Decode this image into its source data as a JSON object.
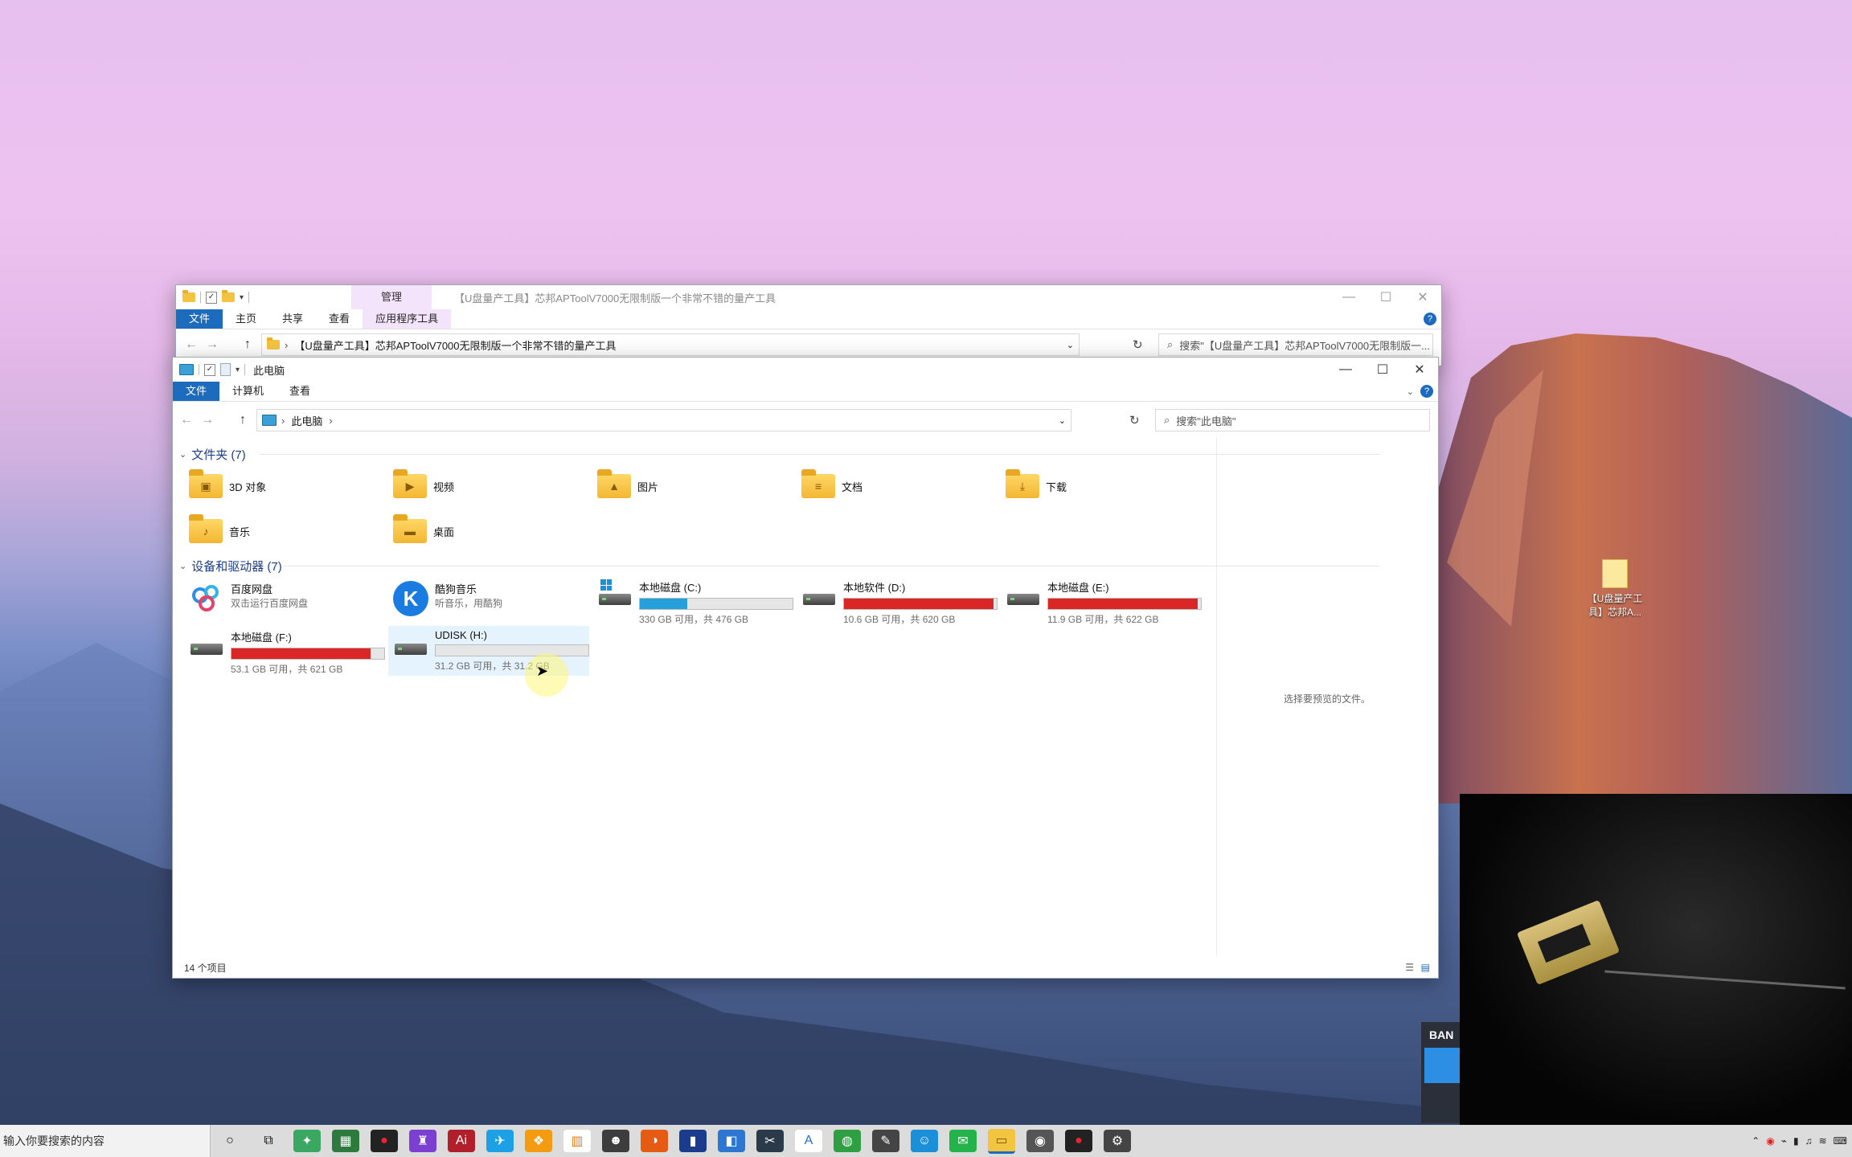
{
  "colors": {
    "accent": "#1c6bbd",
    "drive_full": "#da2626",
    "drive_normal": "#26a0da",
    "selection": "#e5f3ff"
  },
  "back_window": {
    "title": "【U盘量产工具】芯邦APToolV7000无限制版一个非常不错的量产工具",
    "context_tab": "管理",
    "tabs": [
      "文件",
      "主页",
      "共享",
      "查看",
      "应用程序工具"
    ],
    "address": "【U盘量产工具】芯邦APToolV7000无限制版一个非常不错的量产工具",
    "search_placeholder": "搜索\"【U盘量产工具】芯邦APToolV7000无限制版一..."
  },
  "front_window": {
    "title": "此电脑",
    "tabs": [
      "文件",
      "计算机",
      "查看"
    ],
    "address": "此电脑",
    "search_placeholder": "搜索\"此电脑\"",
    "folders_header": "文件夹 (7)",
    "folders": [
      {
        "name": "3D 对象",
        "icon": "cube-icon"
      },
      {
        "name": "视频",
        "icon": "video-icon"
      },
      {
        "name": "图片",
        "icon": "picture-icon"
      },
      {
        "name": "文档",
        "icon": "document-icon"
      },
      {
        "name": "下载",
        "icon": "download-icon"
      },
      {
        "name": "音乐",
        "icon": "music-icon"
      },
      {
        "name": "桌面",
        "icon": "desktop-icon"
      }
    ],
    "devices_header": "设备和驱动器 (7)",
    "apps": [
      {
        "name": "百度网盘",
        "sub": "双击运行百度网盘"
      },
      {
        "name": "酷狗音乐",
        "sub": "听音乐，用酷狗"
      }
    ],
    "drives": [
      {
        "name": "本地磁盘 (C:)",
        "sub": "330 GB 可用，共 476 GB",
        "used": 0.31,
        "full": false,
        "windows": true
      },
      {
        "name": "本地软件 (D:)",
        "sub": "10.6 GB 可用，共 620 GB",
        "used": 0.98,
        "full": true,
        "windows": false
      },
      {
        "name": "本地磁盘 (E:)",
        "sub": "11.9 GB 可用，共 622 GB",
        "used": 0.98,
        "full": true,
        "windows": false
      },
      {
        "name": "本地磁盘 (F:)",
        "sub": "53.1 GB 可用，共 621 GB",
        "used": 0.91,
        "full": true,
        "windows": false
      },
      {
        "name": "UDISK (H:)",
        "sub": "31.2 GB 可用，共 31.2 GB",
        "used": 0.0,
        "full": false,
        "windows": false
      }
    ],
    "preview_text": "选择要预览的文件。",
    "status": "14 个项目"
  },
  "desktop_icon_label": "【U盘量产工具】芯邦A...",
  "taskbar": {
    "search_placeholder": "输入你要搜索的内容"
  },
  "bandicam_label": "BAN"
}
